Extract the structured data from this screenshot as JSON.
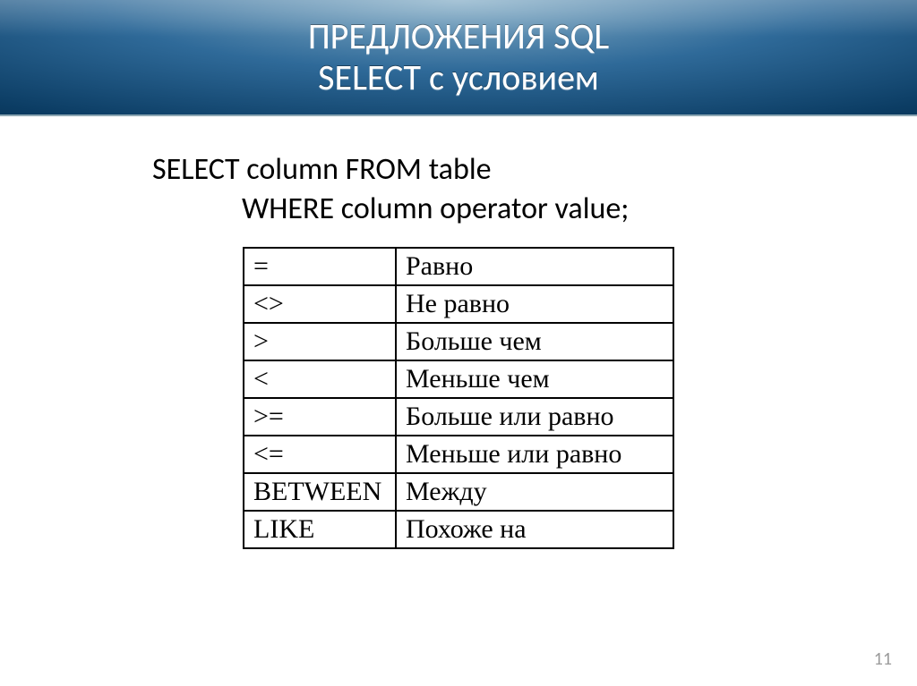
{
  "title": {
    "line1": "ПРЕДЛОЖЕНИЯ SQL",
    "line2": "SELECT с условием"
  },
  "code": {
    "line1": "SELECT column FROM table",
    "line2": "WHERE column operator value;"
  },
  "operators": [
    {
      "symbol": "=",
      "desc": "Равно"
    },
    {
      "symbol": "<>",
      "desc": "Не равно"
    },
    {
      "symbol": ">",
      "desc": "Больше чем"
    },
    {
      "symbol": "<",
      "desc": "Меньше чем"
    },
    {
      "symbol": ">=",
      "desc": "Больше или равно"
    },
    {
      "symbol": "<=",
      "desc": "Меньше или равно"
    },
    {
      "symbol": "BETWEEN",
      "desc": "Между"
    },
    {
      "symbol": "LIKE",
      "desc": "Похоже на"
    }
  ],
  "page_number": "11"
}
